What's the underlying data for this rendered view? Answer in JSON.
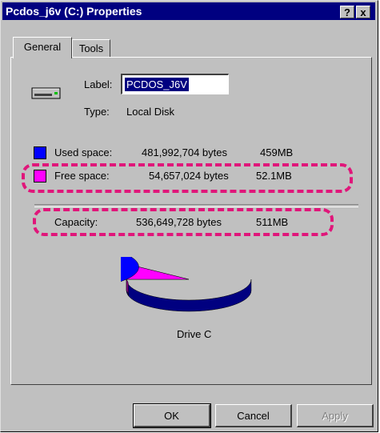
{
  "window": {
    "title": "Pcdos_j6v (C:) Properties",
    "help_button": "?",
    "close_button": "x"
  },
  "tabs": [
    {
      "label": "General",
      "active": true
    },
    {
      "label": "Tools",
      "active": false
    }
  ],
  "general": {
    "label_caption": "Label:",
    "label_value": "PCDOS_J6V",
    "type_caption": "Type:",
    "type_value": "Local Disk",
    "used": {
      "caption": "Used space:",
      "bytes": "481,992,704 bytes",
      "size": "459MB",
      "color": "#0000ff"
    },
    "free": {
      "caption": "Free space:",
      "bytes": "54,657,024 bytes",
      "size": "52.1MB",
      "color": "#ff00ff"
    },
    "capacity": {
      "caption": "Capacity:",
      "bytes": "536,649,728 bytes",
      "size": "511MB"
    },
    "drive_caption": "Drive C",
    "pie": {
      "used_fraction": 0.898,
      "free_fraction": 0.102
    }
  },
  "buttons": {
    "ok": "OK",
    "cancel": "Cancel",
    "apply": "Apply"
  },
  "colors": {
    "titlebar": "#000080",
    "highlight_dash": "#e0167a"
  },
  "icons": {
    "drive": "hard-drive-icon"
  }
}
